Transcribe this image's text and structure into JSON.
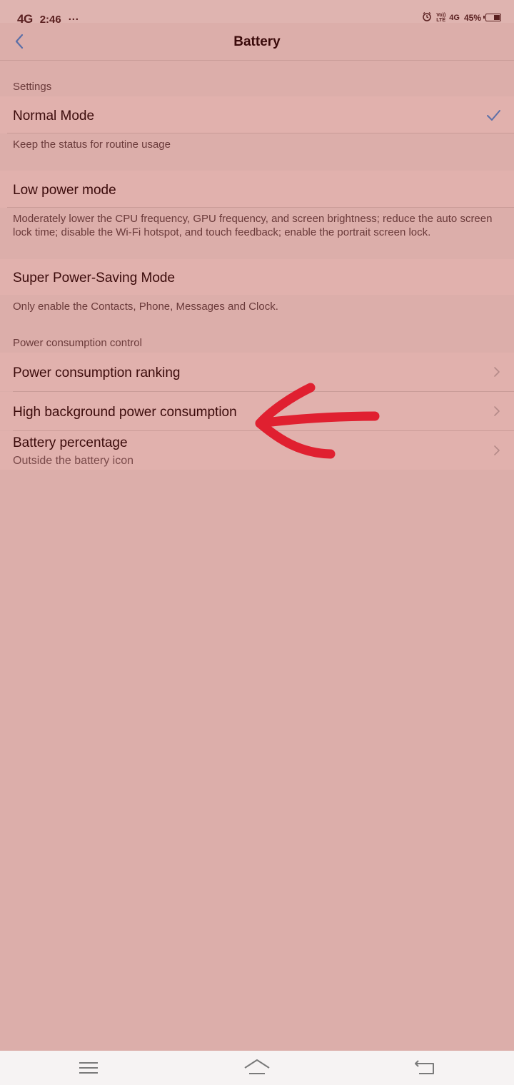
{
  "status_bar": {
    "network": "4G",
    "time": "2:46",
    "more": "···",
    "volte_top": "Vo))",
    "volte_bottom": "LTE",
    "right_network": "4G",
    "battery_percent": "45%",
    "battery_level": 0.45,
    "icons": [
      "alarm-icon",
      "volte-icon",
      "signal-4g-icon",
      "battery-icon"
    ]
  },
  "header": {
    "title": "Battery",
    "back_icon": "chevron-left-icon"
  },
  "settings_section": {
    "label": "Settings",
    "normal_mode": {
      "title": "Normal Mode",
      "description": "Keep the status for routine usage",
      "selected": true
    },
    "low_power_mode": {
      "title": "Low power mode",
      "description": "Moderately lower the CPU frequency, GPU frequency, and screen brightness; reduce the auto screen lock time; disable the Wi-Fi hotspot, and touch feedback; enable the portrait screen lock."
    },
    "super_power_saving": {
      "title": "Super Power-Saving Mode",
      "description": "Only enable the Contacts, Phone, Messages and Clock."
    }
  },
  "power_section": {
    "label": "Power consumption control",
    "items": [
      {
        "title": "Power consumption ranking"
      },
      {
        "title": "High background power consumption"
      },
      {
        "title": "Battery percentage",
        "subtitle": "Outside the battery icon"
      }
    ]
  },
  "colors": {
    "background": "#dcaeaa",
    "row": "#e1b1ad",
    "accent_check": "#5b6fa8",
    "annotation": "#e02030"
  },
  "nav_bar": {
    "icons": [
      "menu-icon",
      "home-icon",
      "back-icon"
    ]
  }
}
